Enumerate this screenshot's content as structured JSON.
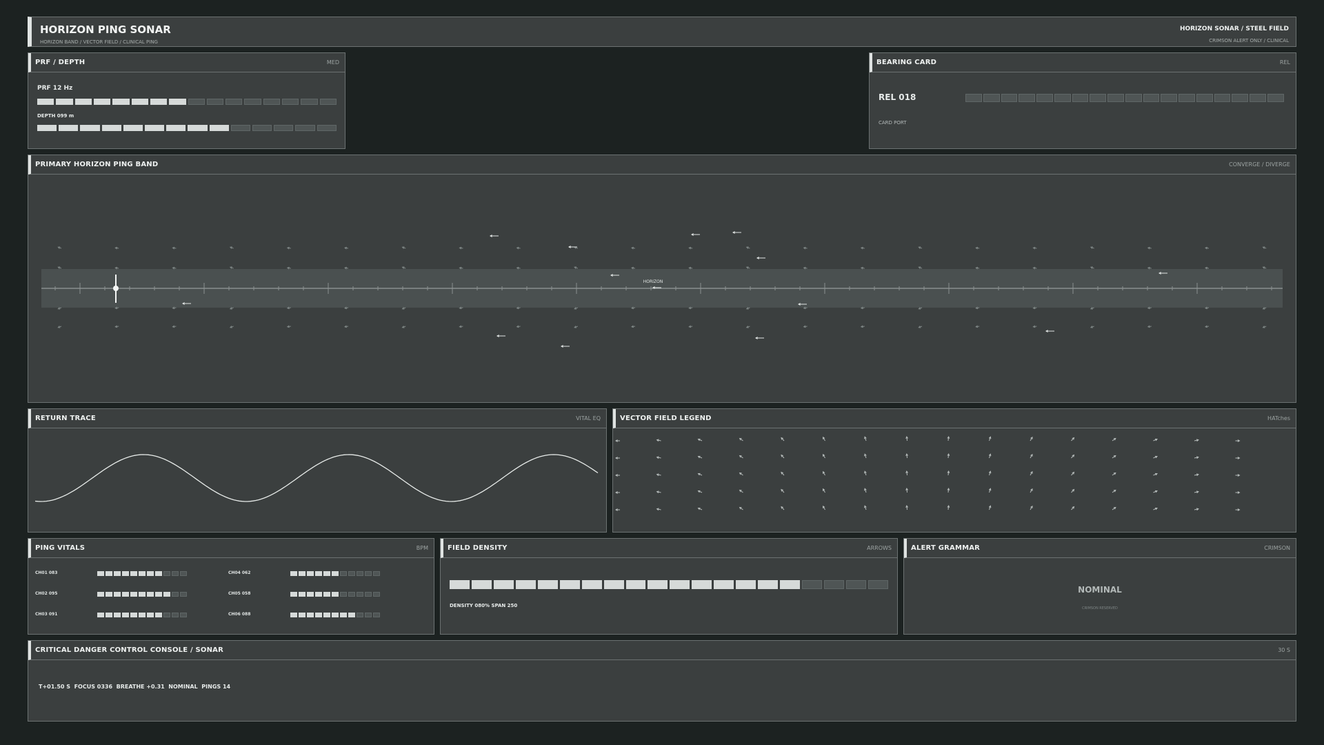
{
  "header": {
    "title": "HORIZON PING SONAR",
    "subtitle": "HORIZON BAND / VECTOR FIELD / CLINICAL PING",
    "right_title": "HORIZON SONAR / STEEL FIELD",
    "right_sub": "CRIMSON ALERT ONLY / CLINICAL"
  },
  "prf_panel": {
    "title": "PRF / DEPTH",
    "tag": "MED",
    "prf_label": "PRF 12 Hz",
    "prf_level": {
      "on": 8,
      "total": 16
    },
    "depth_label": "DEPTH 099 m",
    "depth_level": {
      "on": 9,
      "total": 14
    }
  },
  "bearing_panel": {
    "title": "BEARING CARD",
    "tag": "REL",
    "value": "REL 018",
    "sub": "CARD PORT",
    "segments": 18
  },
  "band_panel": {
    "title": "PRIMARY HORIZON PING BAND",
    "tag": "CONVERGE / DIVERGE",
    "horizon_label": "HORIZON",
    "cursor_fraction": 0.06
  },
  "trace_panel": {
    "title": "RETURN TRACE",
    "tag": "VITAL EQ"
  },
  "legend_panel": {
    "title": "VECTOR FIELD LEGEND",
    "tag": "HATches"
  },
  "vitals_panel": {
    "title": "PING VITALS",
    "tag": "BPM",
    "channels": [
      {
        "label": "CH01 083",
        "on": 8,
        "total": 11
      },
      {
        "label": "CH04 062",
        "on": 6,
        "total": 11
      },
      {
        "label": "CH02 095",
        "on": 9,
        "total": 11
      },
      {
        "label": "CH05 058",
        "on": 6,
        "total": 11
      },
      {
        "label": "CH03 091",
        "on": 8,
        "total": 11
      },
      {
        "label": "CH06 088",
        "on": 8,
        "total": 11
      }
    ]
  },
  "density_panel": {
    "title": "FIELD DENSITY",
    "tag": "ARROWS",
    "level": {
      "on": 16,
      "total": 20
    },
    "readout": "DENSITY 080% SPAN 250"
  },
  "alert_panel": {
    "title": "ALERT GRAMMAR",
    "tag": "CRIMSON",
    "status": "NOMINAL",
    "sub": "CRIMSON RESERVED"
  },
  "console_panel": {
    "title": "CRITICAL DANGER CONTROL CONSOLE / SONAR",
    "tag": "30 S",
    "readout": "T+01.50 S  FOCUS 0336  BREATHE +0.31  NOMINAL  PINGS 14"
  },
  "colors": {
    "background": "#1c2221",
    "panel": "#3b3f3f",
    "border": "#6c7272",
    "segment_on": "#d6dad9",
    "segment_off": "#4f5555"
  }
}
